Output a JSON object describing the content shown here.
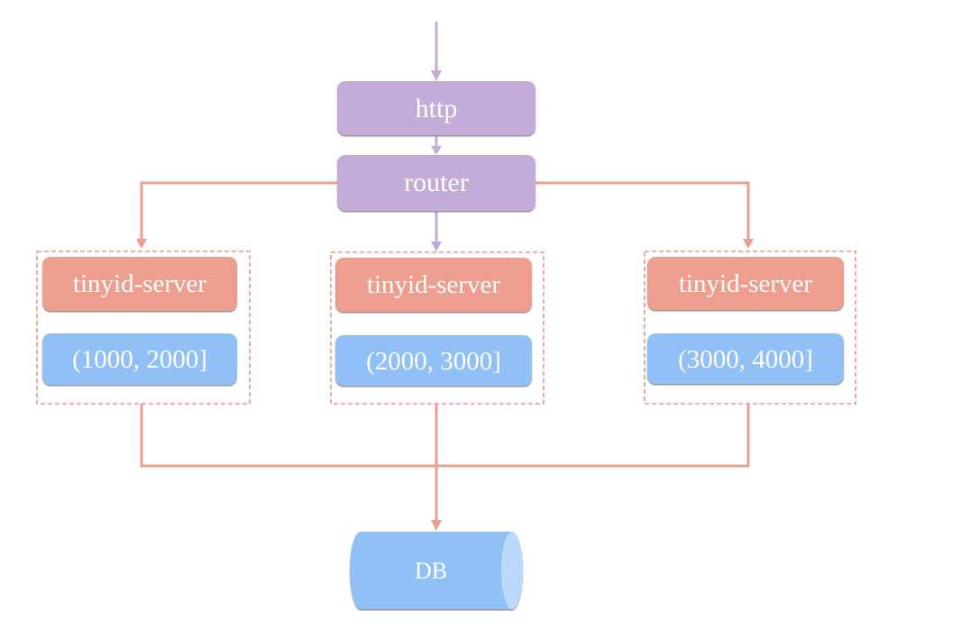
{
  "colors": {
    "purple_node": "#c4acd9",
    "purple_line": "#c4acd9",
    "salmon_node": "#ee9e8e",
    "salmon_line": "#ee9e8e",
    "blue_node": "#90c0f6",
    "blue_cap": "#bcd8fa",
    "text": "#ffffff",
    "dashed_border": "#e8968a"
  },
  "nodes": {
    "http": {
      "label": "http"
    },
    "router": {
      "label": "router"
    },
    "servers": [
      {
        "label": "tinyid-server",
        "range": "(1000, 2000]"
      },
      {
        "label": "tinyid-server",
        "range": "(2000, 3000]"
      },
      {
        "label": "tinyid-server",
        "range": "(3000, 4000]"
      }
    ],
    "db": {
      "label": "DB"
    }
  }
}
